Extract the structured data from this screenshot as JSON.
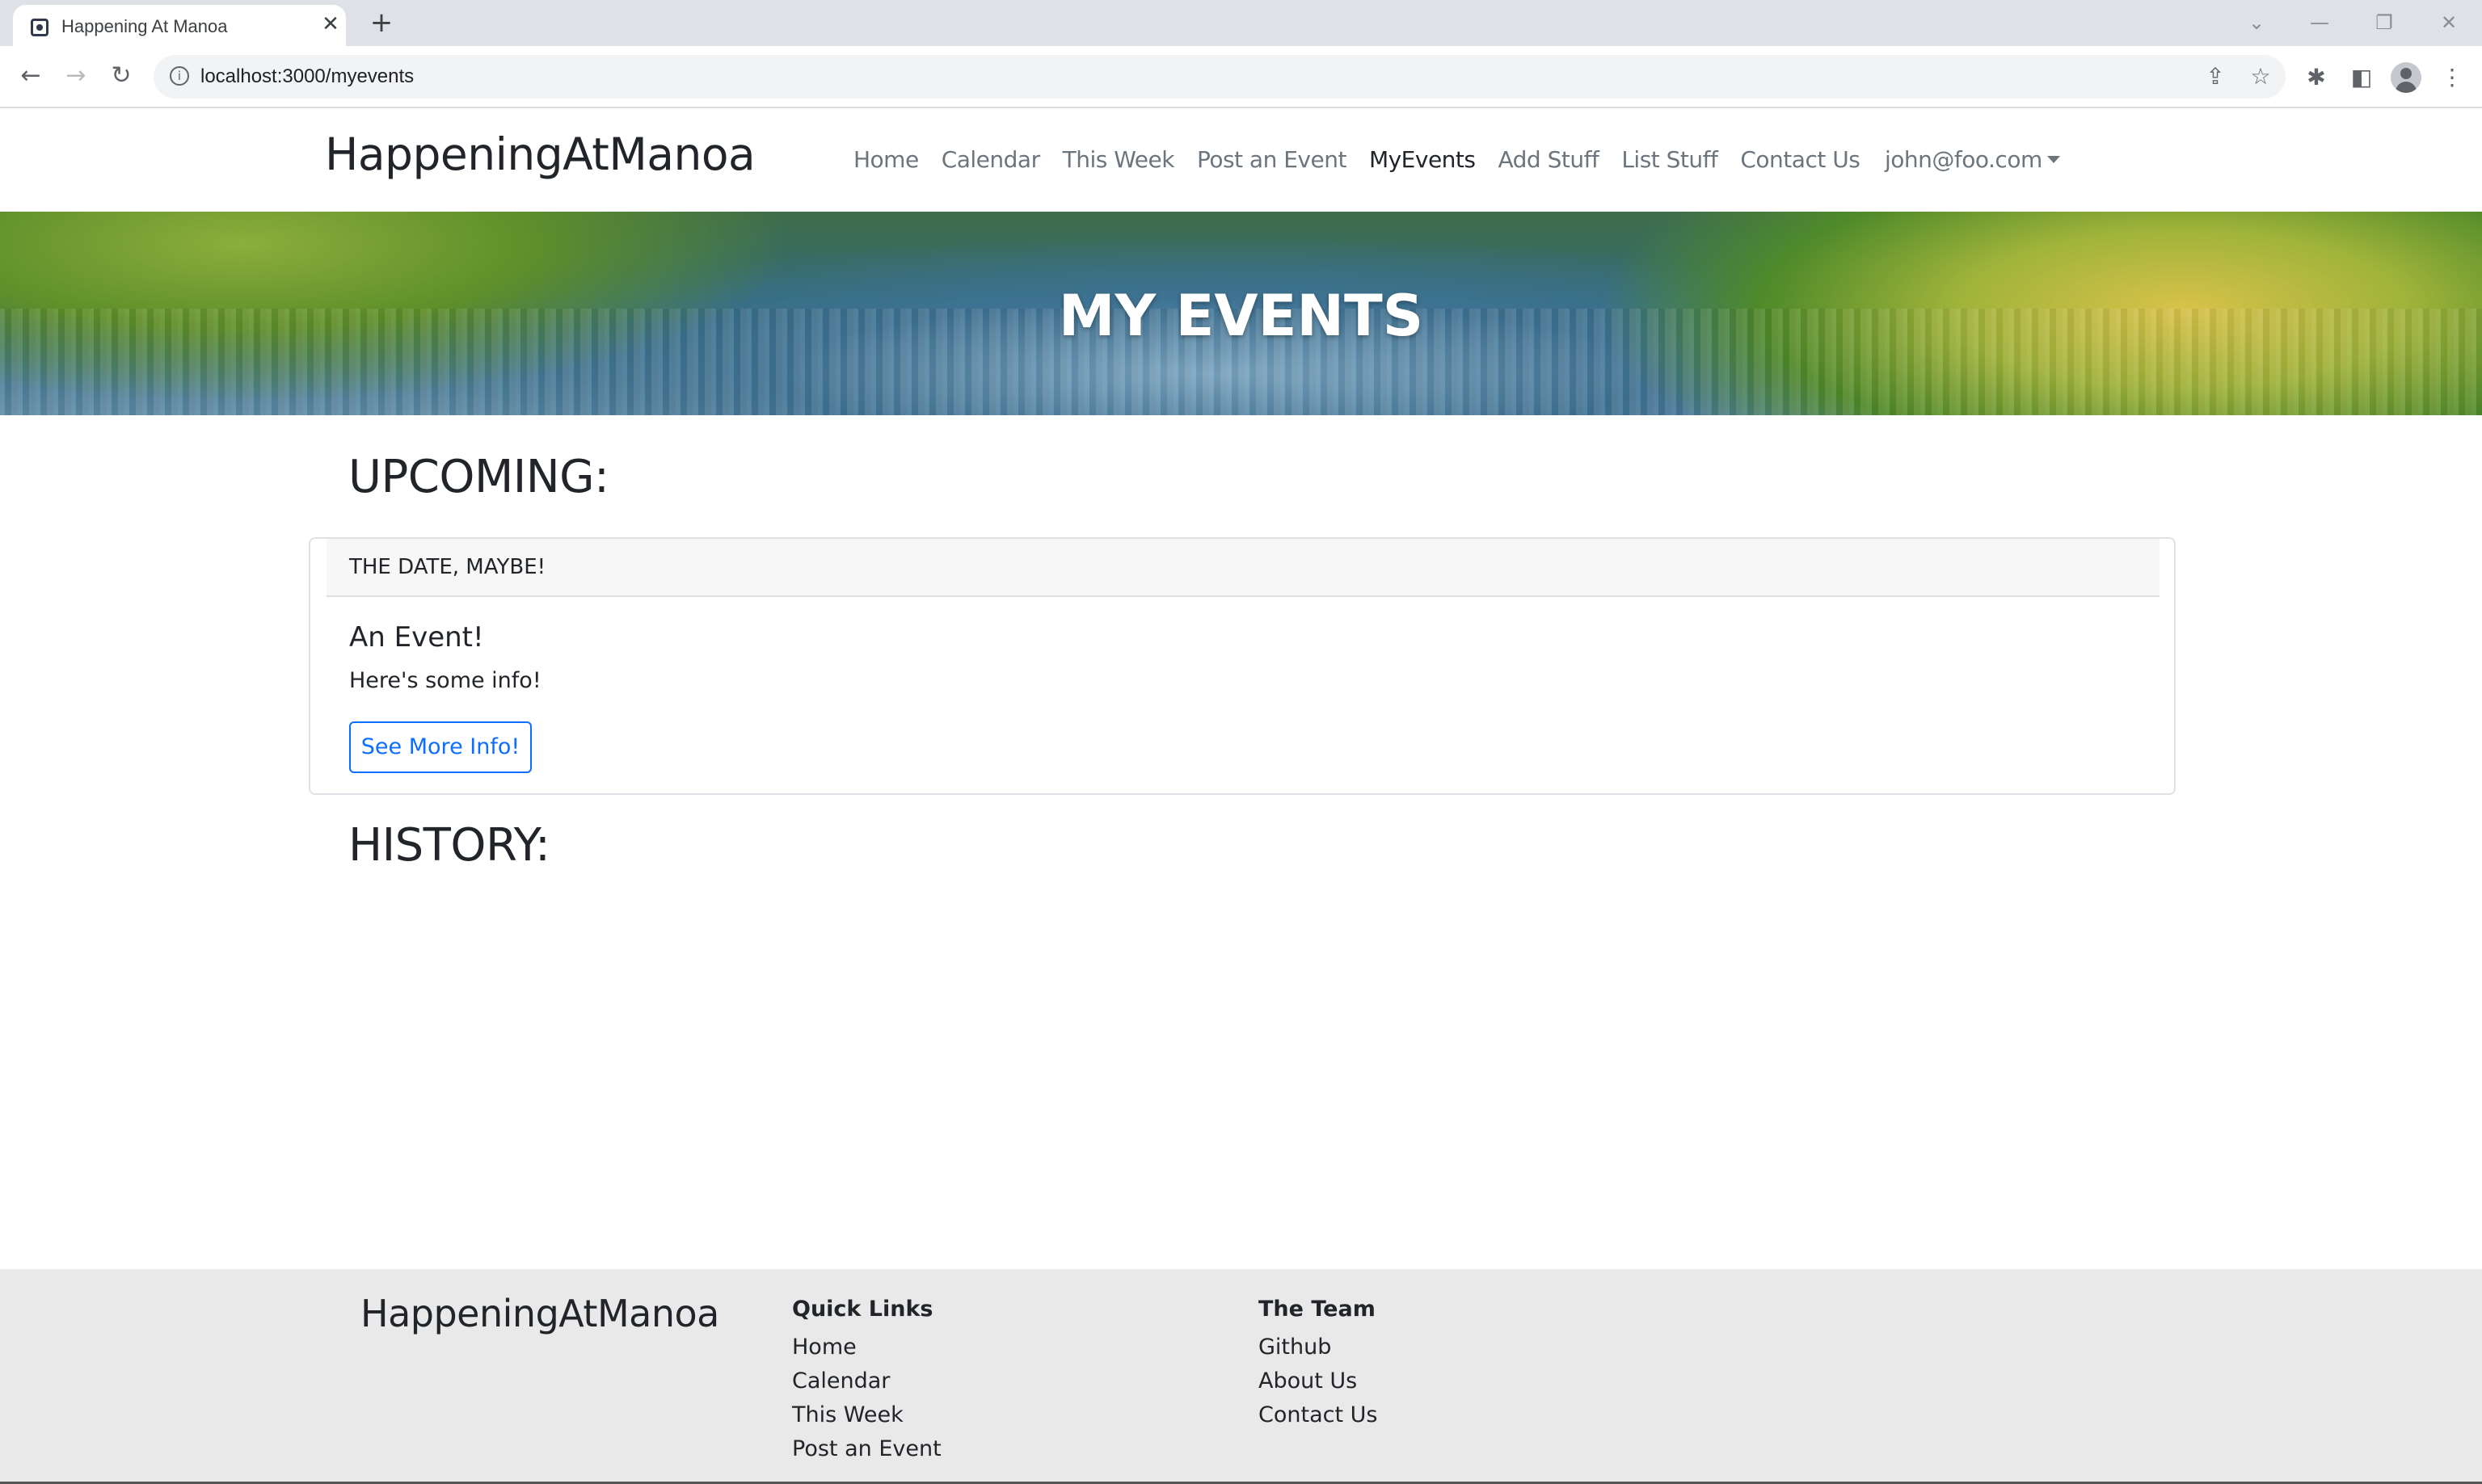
{
  "browser": {
    "tab_title": "Happening At Manoa",
    "tab_close": "✕",
    "new_tab": "+",
    "url": "localhost:3000/myevents",
    "win_minimize": "—",
    "win_restore": "❐",
    "win_close": "✕",
    "win_tabsearch": "⌄",
    "back": "←",
    "forward": "→",
    "reload": "↻",
    "share": "⇪",
    "bookmark": "☆",
    "extensions": "✱",
    "sidepanel": "◧",
    "menu": "⋮",
    "info": "i"
  },
  "navbar": {
    "brand": "HappeningAtManoa",
    "links": [
      {
        "label": "Home"
      },
      {
        "label": "Calendar"
      },
      {
        "label": "This Week"
      },
      {
        "label": "Post an Event"
      },
      {
        "label": "MyEvents"
      },
      {
        "label": "Add Stuff"
      },
      {
        "label": "List Stuff"
      },
      {
        "label": "Contact Us"
      }
    ],
    "user": "john@foo.com"
  },
  "hero": {
    "title": "MY EVENTS"
  },
  "upcoming": {
    "heading": "UPCOMING:",
    "card": {
      "header": "THE DATE, MAYBE!",
      "title": "An Event!",
      "text": "Here's some info!",
      "button": "See More Info!"
    }
  },
  "history": {
    "heading": "HISTORY:"
  },
  "footer": {
    "brand": "HappeningAtManoa",
    "quick_links": {
      "title": "Quick Links",
      "items": [
        "Home",
        "Calendar",
        "This Week",
        "Post an Event"
      ]
    },
    "team": {
      "title": "The Team",
      "items": [
        "Github",
        "About Us",
        "Contact Us"
      ]
    }
  }
}
